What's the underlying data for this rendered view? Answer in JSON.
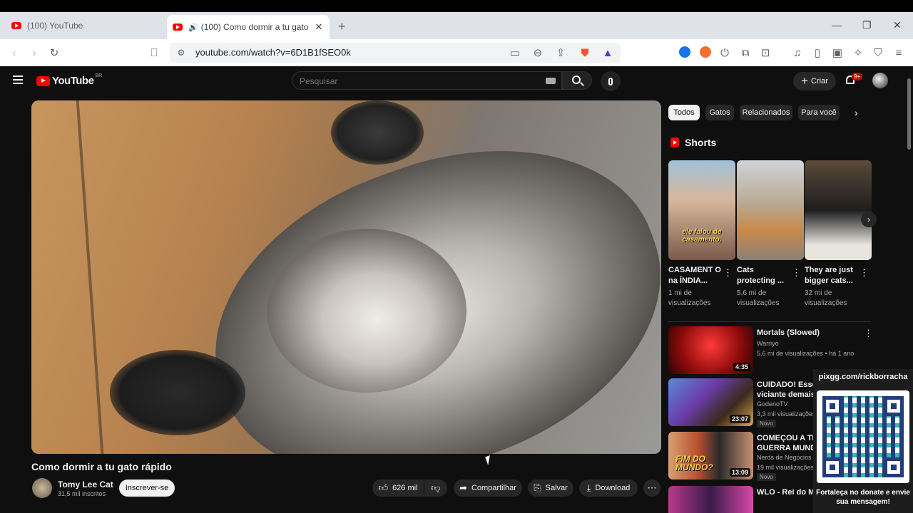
{
  "browser": {
    "tabs": [
      {
        "title": "(100) YouTube",
        "active": false
      },
      {
        "title": "(100) Como dormir a tu gato",
        "active": true
      }
    ],
    "url": "youtube.com/watch?v=6D1B1fSEO0k"
  },
  "yt": {
    "logo": "YouTube",
    "country": "BR",
    "search_placeholder": "Pesquisar",
    "create_label": "Criar",
    "notif_badge": "9+"
  },
  "video": {
    "title": "Como dormir a tu gato rápido",
    "channel": "Tomy Lee Cat",
    "subscribers": "31,5 mil inscritos",
    "subscribe_label": "Inscrever-se",
    "likes": "626 mil",
    "share_label": "Compartilhar",
    "save_label": "Salvar",
    "download_label": "Download"
  },
  "chips": [
    "Todos",
    "Gatos",
    "Relacionados",
    "Para você"
  ],
  "shorts": {
    "heading": "Shorts",
    "items": [
      {
        "title": "CASAMENT O na ÍNDIA...",
        "views": "1 mi de visualizações",
        "caption": "ele falou de casamento,"
      },
      {
        "title": "Cats protecting ...",
        "views": "5,6 mi de visualizações"
      },
      {
        "title": "They are just bigger cats...",
        "views": "32 mi de visualizações"
      }
    ]
  },
  "recs": [
    {
      "title": "Mortals (Slowed)",
      "channel": "Warriyo",
      "meta": "5,6 mi de visualizações • há 1 ano",
      "duration": "4:35"
    },
    {
      "title": "CUIDADO! Esse jo é viciante demais",
      "channel": "GodenoTV",
      "meta": "3,3 mil visualizações",
      "duration": "23:07",
      "badge": "Novo"
    },
    {
      "title": "COMEÇOU A TER GUERRA MUNDIA",
      "channel": "Nerds de Negócios",
      "meta": "19 mil visualizações",
      "duration": "13:09",
      "badge": "Novo",
      "thumb_text": "FIM DO MUNDO?"
    },
    {
      "title": "WLO - Rei do Mun"
    }
  ],
  "overlay": {
    "link": "pixgg.com/rickborracha",
    "message": "Fortaleça no donate e envie sua mensagem!"
  }
}
